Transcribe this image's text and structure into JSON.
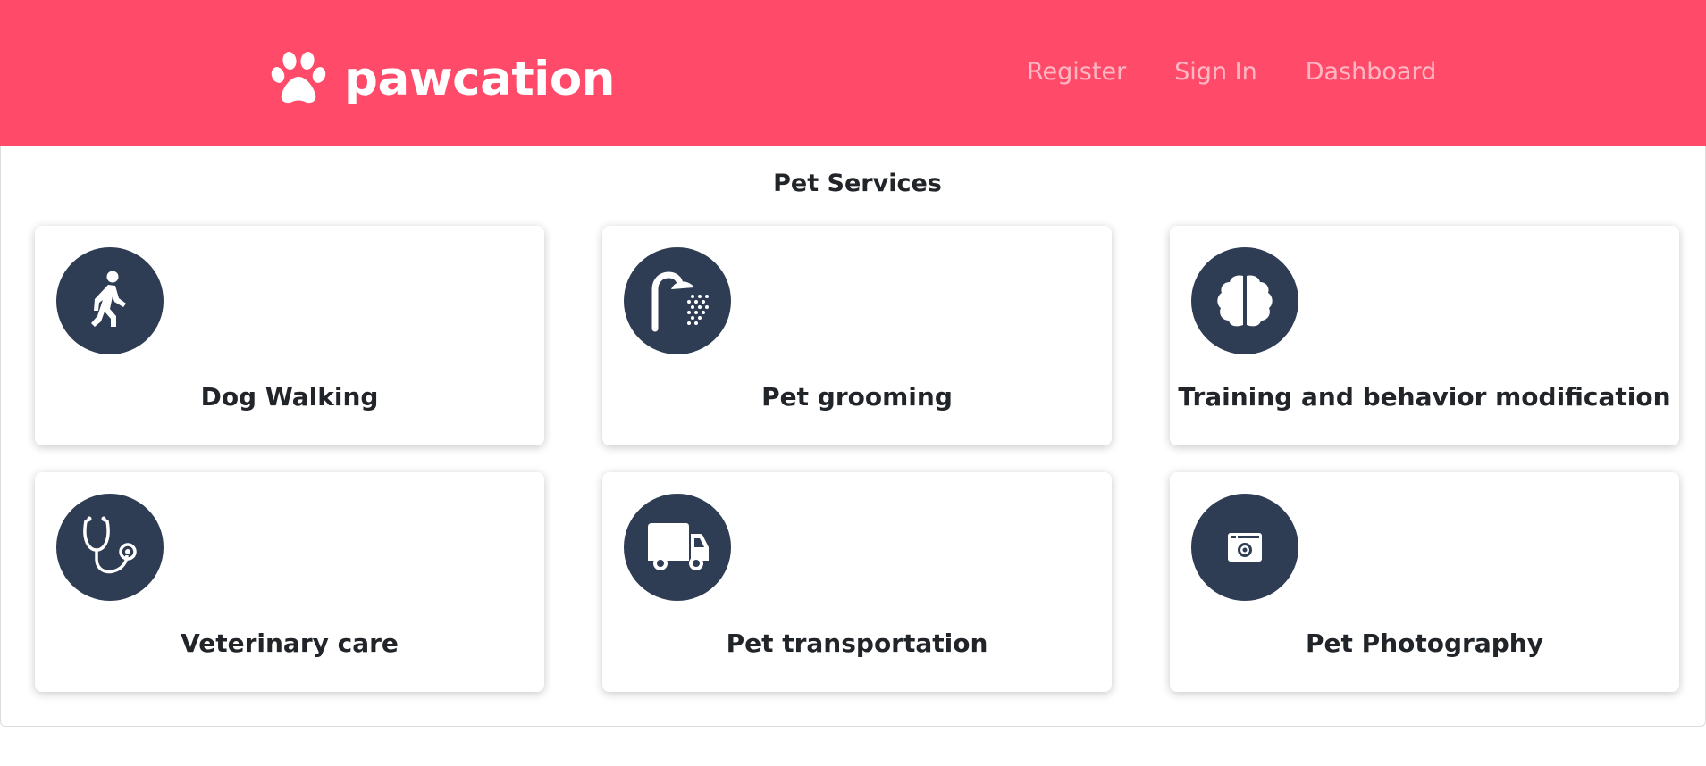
{
  "header": {
    "brand_name": "pawcation",
    "brand_icon": "paw-icon",
    "brand_color": "#ff4b69",
    "nav": [
      {
        "label": "Register"
      },
      {
        "label": "Sign In"
      },
      {
        "label": "Dashboard"
      }
    ]
  },
  "main": {
    "title": "Pet Services",
    "icon_bg_color": "#2e3d53",
    "services": [
      {
        "label": "Dog Walking",
        "icon": "walking-person-icon"
      },
      {
        "label": "Pet grooming",
        "icon": "shower-icon"
      },
      {
        "label": "Training and behavior modification",
        "icon": "brain-icon"
      },
      {
        "label": "Veterinary care",
        "icon": "stethoscope-icon"
      },
      {
        "label": "Pet transportation",
        "icon": "truck-icon"
      },
      {
        "label": "Pet Photography",
        "icon": "camera-icon"
      }
    ]
  }
}
